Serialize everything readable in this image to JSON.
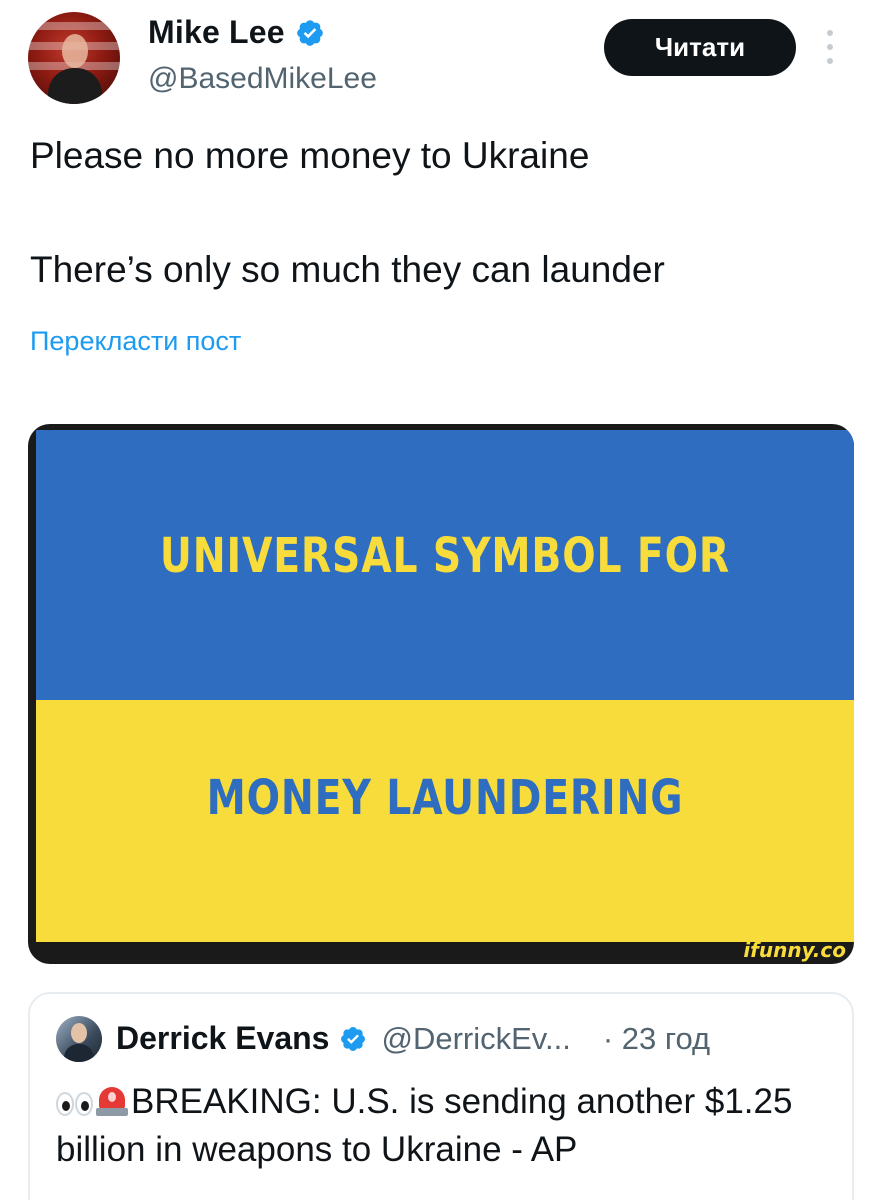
{
  "tweet": {
    "author_name": "Mike Lee",
    "author_handle": "@BasedMikeLee",
    "follow_label": "Читати",
    "text_line1": "Please no more money to Ukraine",
    "text_line2": "There’s only so much they can launder",
    "translate_label": "Перекласти пост"
  },
  "media": {
    "top_text": "UNIVERSAL SYMBOL FOR",
    "bottom_text": "MONEY LAUNDERING",
    "watermark": "ifunny.co",
    "colors": {
      "blue": "#2e6dbf",
      "yellow": "#f7dc3b"
    }
  },
  "quoted_tweet": {
    "author_name": "Derrick Evans",
    "author_handle": "@DerrickEv...",
    "time": "· 23 год",
    "text": "BREAKING: U.S. is sending another $1.25 billion in weapons to Ukraine - AP",
    "emoji_icons": [
      "eyes-icon",
      "siren-icon"
    ]
  },
  "colors": {
    "accent": "#1d9bf0",
    "text": "#0f1419",
    "secondary": "#536471"
  }
}
